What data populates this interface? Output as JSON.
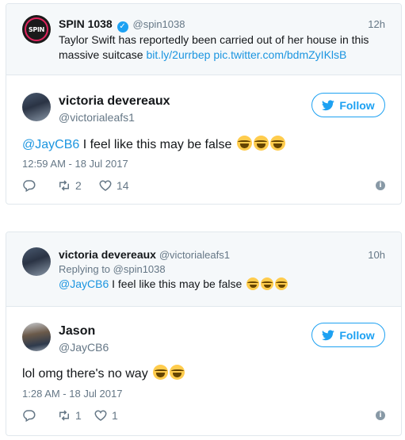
{
  "colors": {
    "accent": "#1da1f2",
    "link": "#1b95e0",
    "muted": "#657786",
    "border": "#e1e8ed",
    "quote_bg": "#f5f8fa"
  },
  "embed1": {
    "quoted": {
      "avatar_icon": "spin-1038-logo",
      "avatar_text": "SPIN",
      "name": "SPIN 1038",
      "handle": "@spin1038",
      "time": "12h",
      "text": "Taylor Swift has reportedly been carried out of her house in this massive suitcase",
      "link1": "bit.ly/2urrbep",
      "link2": "pic.twitter.com/bdmZyIKlsB"
    },
    "reply": {
      "name": "victoria devereaux",
      "handle": "@victorialeafs1",
      "follow_label": "Follow",
      "mention": "@JayCB6",
      "text": " I feel like this may be false ",
      "timestamp": "12:59 AM - 18 Jul 2017",
      "retweets": "2",
      "likes": "14"
    }
  },
  "embed2": {
    "quoted": {
      "name": "victoria devereaux",
      "handle": "@victorialeafs1",
      "time": "10h",
      "replying_prefix": "Replying to ",
      "replying_to": "@spin1038",
      "mention": "@JayCB6",
      "text": " I feel like this may be false "
    },
    "reply": {
      "name": "Jason",
      "handle": "@JayCB6",
      "follow_label": "Follow",
      "text": "lol omg there's no way ",
      "timestamp": "1:28 AM - 18 Jul 2017",
      "retweets": "1",
      "likes": "1"
    }
  }
}
